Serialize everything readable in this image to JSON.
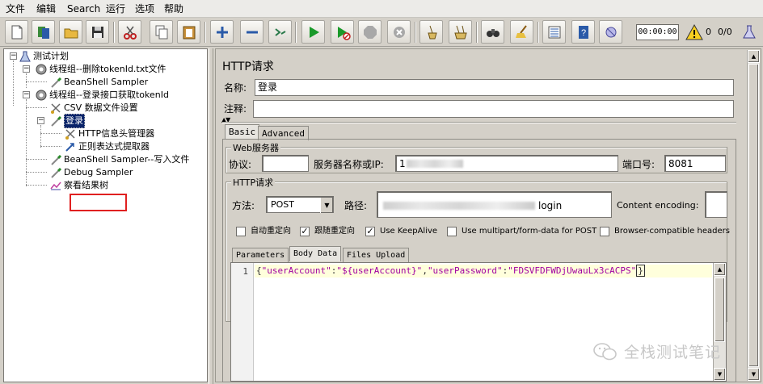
{
  "menu": [
    "文件",
    "编辑",
    "Search",
    "运行",
    "选项",
    "帮助"
  ],
  "toolbar": {
    "timer": "00:00:00",
    "error_count": "0",
    "threads": "0/0",
    "icons": [
      "new-icon",
      "templates-icon",
      "open-icon",
      "save-icon",
      "cut-icon",
      "copy-icon",
      "paste-icon",
      "expand-icon",
      "collapse-icon",
      "toggle-icon",
      "start-icon",
      "start-no-timers-icon",
      "stop-icon",
      "shutdown-icon",
      "clear-icon",
      "clear-all-icon",
      "search-icon",
      "reset-search-icon",
      "function-helper-icon",
      "help-icon",
      "remote-icon"
    ]
  },
  "tree": {
    "nodes": [
      {
        "label": "测试计划",
        "icon": "test-plan-icon"
      },
      {
        "label": "线程组--删除tokenId.txt文件",
        "icon": "gear-icon"
      },
      {
        "label": "BeanShell Sampler",
        "icon": "pipette-icon"
      },
      {
        "label": "线程组--登录接口获取tokenId",
        "icon": "gear-icon"
      },
      {
        "label": "CSV 数据文件设置",
        "icon": "scissors-icon"
      },
      {
        "label": "登录",
        "icon": "pipette-icon"
      },
      {
        "label": "HTTP信息头管理器",
        "icon": "scissors-icon"
      },
      {
        "label": "正则表达式提取器",
        "icon": "extractor-icon"
      },
      {
        "label": "BeanShell Sampler--写入文件",
        "icon": "pipette-icon"
      },
      {
        "label": "Debug Sampler",
        "icon": "pipette-icon"
      },
      {
        "label": "察看结果树",
        "icon": "result-tree-icon"
      }
    ]
  },
  "sampler": {
    "title": "HTTP请求",
    "name_label": "名称:",
    "name_value": "登录",
    "comment_label": "注释:",
    "comment_value": ""
  },
  "tabs": {
    "basic": "Basic",
    "advanced": "Advanced"
  },
  "web_server": {
    "title": "Web服务器",
    "protocol_label": "协议:",
    "protocol_value": "",
    "server_label": "服务器名称或IP:",
    "server_value": "1",
    "port_label": "端口号:",
    "port_value": "8081"
  },
  "http_request": {
    "title": "HTTP请求",
    "method_label": "方法:",
    "method_value": "POST",
    "path_label": "路径:",
    "path_value": "login",
    "encoding_label": "Content encoding:",
    "encoding_value": ""
  },
  "options": [
    {
      "label": "自动重定向",
      "checked": false
    },
    {
      "label": "跟随重定向",
      "checked": true
    },
    {
      "label": "Use KeepAlive",
      "checked": true
    },
    {
      "label": "Use multipart/form-data for POST",
      "checked": false
    },
    {
      "label": "Browser-compatible headers",
      "checked": false
    }
  ],
  "body_tabs": [
    "Parameters",
    "Body Data",
    "Files Upload"
  ],
  "editor": {
    "line_number": "1",
    "key1": "\"userAccount\"",
    "val1": "\"${userAccount}\"",
    "key2": "\"userPassword\"",
    "val2": "\"FDSVFDFWDjUwauLx3cACPS\"",
    "open_brace": "{",
    "colon": ":",
    "comma": ",",
    "close_brace": "}"
  },
  "watermark": "全栈测试笔记",
  "colors": {
    "selection": "#0a246a",
    "highlight_box": "#e02020",
    "code_string": "#a000a0",
    "code_line_bg": "#ffffdc"
  }
}
